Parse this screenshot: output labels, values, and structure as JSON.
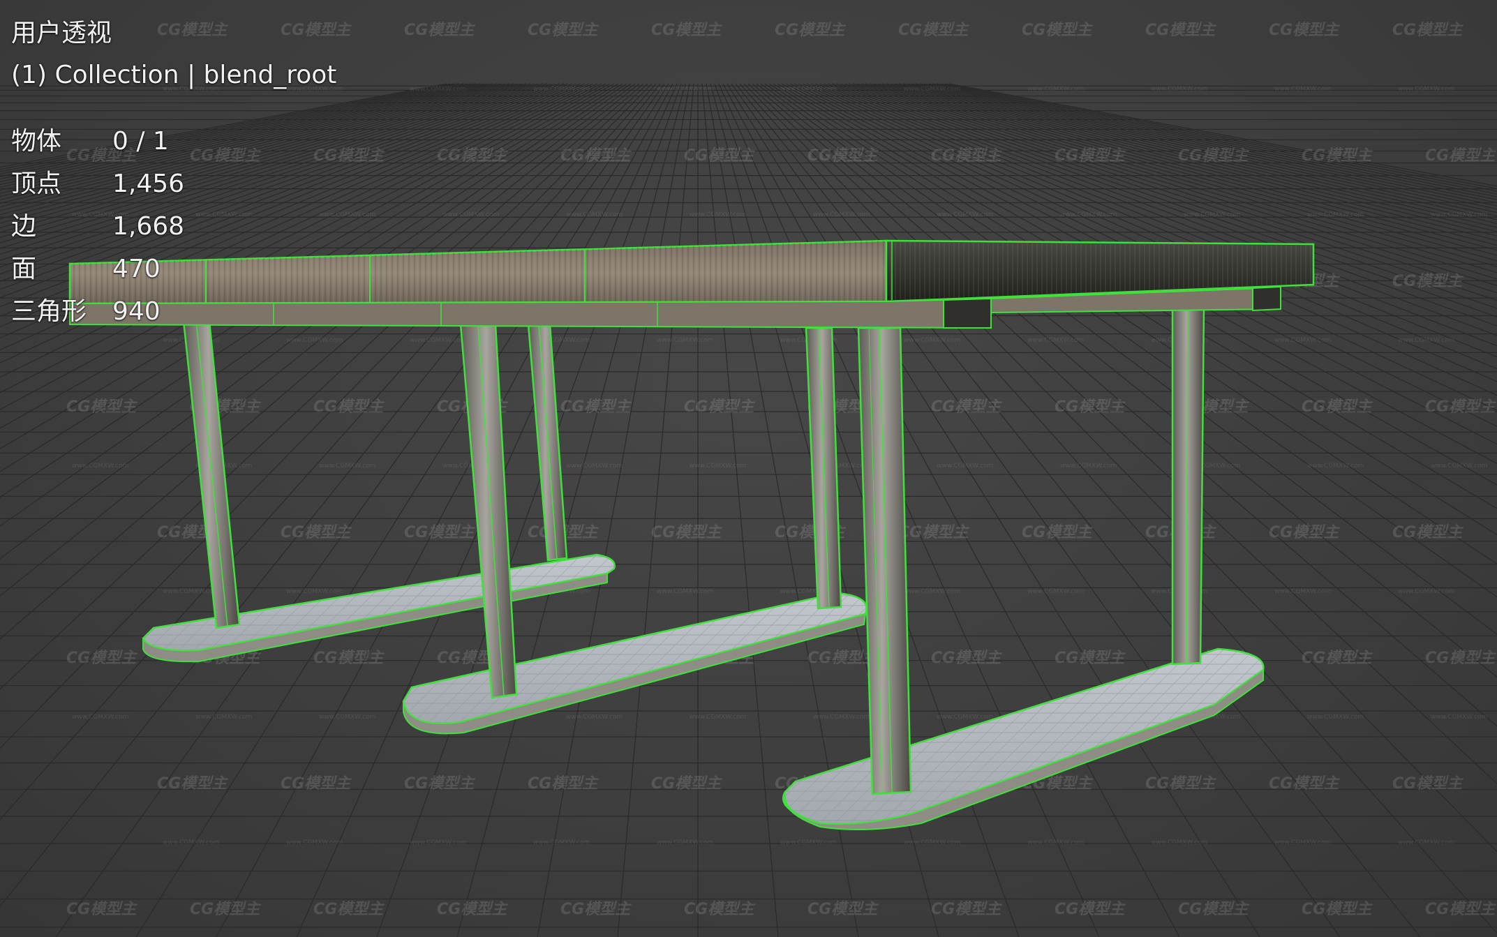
{
  "viewport": {
    "view_name": "用户透视",
    "collection_label": "(1) Collection | blend_root",
    "stats": [
      {
        "label": "物体",
        "value": "0 / 1"
      },
      {
        "label": "顶点",
        "value": "1,456"
      },
      {
        "label": "边",
        "value": "1,668"
      },
      {
        "label": "面",
        "value": "470"
      },
      {
        "label": "三角形",
        "value": "940"
      }
    ]
  },
  "watermark": {
    "text": "CG模型主",
    "url": "www.CGMXW.com"
  },
  "colors": {
    "background": "#3d3d3d",
    "grid_line": "#2a2a2a",
    "wireframe_select": "#3fe23a",
    "concrete": "#b5b9c0",
    "wood": "#8a7a66",
    "metal_dark": "#2c2c28"
  }
}
